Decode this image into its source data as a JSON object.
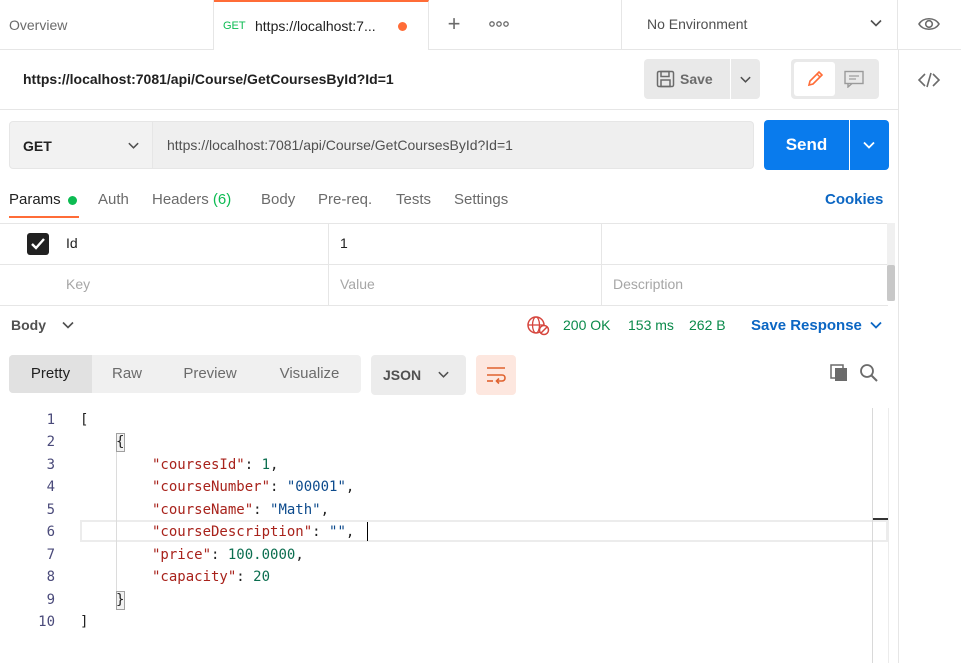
{
  "tabs": {
    "overview": "Overview",
    "active_method": "GET",
    "active_title": "https://localhost:7...",
    "environment": "No Environment"
  },
  "request": {
    "title": "https://localhost:7081/api/Course/GetCoursesById?Id=1",
    "save_label": "Save",
    "method": "GET",
    "url": "https://localhost:7081/api/Course/GetCoursesById?Id=1",
    "send_label": "Send"
  },
  "req_tabs": {
    "params": "Params",
    "auth": "Auth",
    "headers": "Headers",
    "headers_count": "(6)",
    "body": "Body",
    "prereq": "Pre-req.",
    "tests": "Tests",
    "settings": "Settings",
    "cookies": "Cookies"
  },
  "params": {
    "rows": [
      {
        "key": "Id",
        "value": "1",
        "description": "",
        "checked": true
      }
    ],
    "placeholder": {
      "key": "Key",
      "value": "Value",
      "description": "Description"
    }
  },
  "response": {
    "body_label": "Body",
    "status": "200 OK",
    "time": "153 ms",
    "size": "262 B",
    "save_response": "Save Response",
    "formats": [
      "Pretty",
      "Raw",
      "Preview",
      "Visualize"
    ],
    "language": "JSON",
    "line_numbers": [
      "1",
      "2",
      "3",
      "4",
      "5",
      "6",
      "7",
      "8",
      "9",
      "10"
    ],
    "json": {
      "open_bracket": "[",
      "open_brace": "{",
      "fields": [
        {
          "key": "\"coursesId\"",
          "value": "1",
          "type": "number",
          "trail": ","
        },
        {
          "key": "\"courseNumber\"",
          "value": "\"00001\"",
          "type": "string",
          "trail": ","
        },
        {
          "key": "\"courseName\"",
          "value": "\"Math\"",
          "type": "string",
          "trail": ","
        },
        {
          "key": "\"courseDescription\"",
          "value": "\"\"",
          "type": "string",
          "trail": ","
        },
        {
          "key": "\"price\"",
          "value": "100.0000",
          "type": "number",
          "trail": ","
        },
        {
          "key": "\"capacity\"",
          "value": "20",
          "type": "number",
          "trail": ""
        }
      ],
      "close_brace": "}",
      "close_bracket": "]"
    }
  },
  "colors": {
    "accent": "#ff6c37",
    "send": "#097bed",
    "success": "#0cbb52",
    "link": "#0b66c3"
  }
}
